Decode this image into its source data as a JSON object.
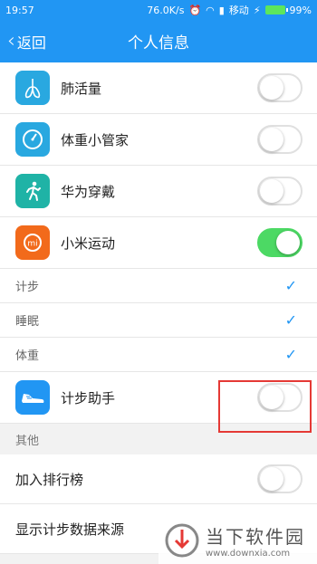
{
  "status": {
    "time": "19:57",
    "speed": "76.0K/s",
    "carrier": "移动",
    "battery": "99%"
  },
  "appbar": {
    "back_label": "返回",
    "title": "个人信息"
  },
  "apps": [
    {
      "label": "肺活量",
      "icon": "lungs-icon",
      "color": "#29a8e0",
      "enabled": false
    },
    {
      "label": "体重小管家",
      "icon": "gauge-icon",
      "color": "#29a8e0",
      "enabled": false
    },
    {
      "label": "华为穿戴",
      "icon": "runner-icon",
      "color": "#1fb3a6",
      "enabled": false
    },
    {
      "label": "小米运动",
      "icon": "mi-icon",
      "color": "#f26a1b",
      "enabled": true
    }
  ],
  "mi_sub": [
    {
      "label": "计步",
      "checked": true
    },
    {
      "label": "睡眠",
      "checked": true
    },
    {
      "label": "体重",
      "checked": true
    }
  ],
  "step_helper": {
    "label": "计步助手",
    "icon": "shoe-icon",
    "color": "#2196f3",
    "enabled": false
  },
  "other": {
    "header": "其他",
    "rank_label": "加入排行榜",
    "rank_enabled": false,
    "source_label": "显示计步数据来源"
  },
  "watermark": {
    "title": "当下软件园",
    "url": "www.downxia.com"
  },
  "colors": {
    "accent": "#2196f3",
    "toggle_on": "#4cd964",
    "highlight": "#e53935"
  }
}
